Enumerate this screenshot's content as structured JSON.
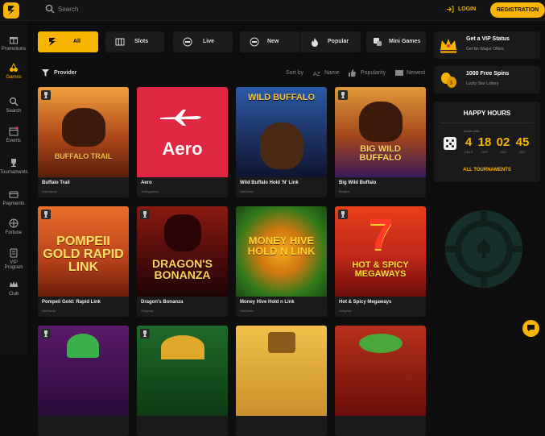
{
  "header": {
    "search_placeholder": "Search",
    "login_label": "LOGIN",
    "register_label": "REGISTRATION",
    "accent": "#f7b500"
  },
  "sidebar": {
    "items": [
      {
        "label": "Promotions",
        "icon": "gift-icon",
        "active": false
      },
      {
        "label": "Games",
        "icon": "cherries-icon",
        "active": true
      },
      {
        "label": "Search",
        "icon": "search-icon",
        "active": false
      },
      {
        "label": "Events",
        "icon": "calendar-icon",
        "active": false
      },
      {
        "label": "Tournaments",
        "icon": "trophy-icon",
        "active": false
      },
      {
        "label": "Payments",
        "icon": "card-icon",
        "active": false
      },
      {
        "label": "Fortune",
        "icon": "wheel-icon",
        "active": false
      },
      {
        "label": "VIP Program",
        "icon": "vip-icon",
        "active": false
      },
      {
        "label": "Club",
        "icon": "crown-icon",
        "active": false
      }
    ]
  },
  "tabs": [
    {
      "label": "All",
      "icon": "lightning-icon",
      "active": true
    },
    {
      "label": "Slots",
      "icon": "slots-icon",
      "active": false
    },
    {
      "label": "Live",
      "icon": "live-icon",
      "active": false
    },
    {
      "label": "New",
      "icon": "new-icon",
      "active": false
    },
    {
      "label": "Popular",
      "icon": "fire-icon",
      "active": false
    },
    {
      "label": "Mini Games",
      "icon": "dice-icon",
      "active": false
    }
  ],
  "filters": {
    "provider_label": "Provider",
    "sort_by_label": "Sort by",
    "sort_options": [
      "Name",
      "Popularity",
      "Newest"
    ]
  },
  "games": [
    {
      "title": "Buffalo Trail",
      "provider": "Gamebeat",
      "art": "BUFFALO TRAIL",
      "bg": "#8a3a14",
      "fg": "#f5c542"
    },
    {
      "title": "Aero",
      "provider": "Turbogames",
      "art": "Aero",
      "bg": "#d9263a",
      "fg": "#ffffff"
    },
    {
      "title": "Wild Buffalo Hold 'N' Link",
      "provider": "NetGame",
      "art": "WILD BUFFALO",
      "bg": "#1d3a6e",
      "fg": "#f5c542"
    },
    {
      "title": "Big Wild Buffalo",
      "provider": "Belatra",
      "art": "BIG WILD BUFFALO",
      "bg": "#6e2a14",
      "fg": "#ffd35a"
    },
    {
      "title": "Pompeii Gold: Rapid Link",
      "provider": "NetGame",
      "art": "POMPEII GOLD RAPID LINK",
      "bg": "#b8501a",
      "fg": "#ffe066"
    },
    {
      "title": "Dragon's Bonanza",
      "provider": "Onlyplay",
      "art": "DRAGON'S BONANZA",
      "bg": "#5a0e0e",
      "fg": "#ffd35a"
    },
    {
      "title": "Money Hive Hold n Link",
      "provider": "NetGame",
      "art": "MONEY HIVE HOLD N LINK",
      "bg": "#2f7a1c",
      "fg": "#ffcf2e"
    },
    {
      "title": "Hot & Spicy Megaways",
      "provider": "Onlyplay",
      "art": "HOT & SPICY MEGAWAYS",
      "bg": "#c2271a",
      "fg": "#ffde3b"
    }
  ],
  "promos": [
    {
      "title": "Get a VIP Status",
      "subtitle": "Get No Wager Offers",
      "icon": "crown-icon"
    },
    {
      "title": "1000 Free Spins",
      "subtitle": "Lucky Star Lottery",
      "icon": "coins-icon"
    }
  ],
  "happy_hours": {
    "title": "HAPPY HOURS",
    "active_label": "Active with:",
    "countdown": [
      {
        "value": "4",
        "unit": "DAYS"
      },
      {
        "value": "18",
        "unit": "HRS"
      },
      {
        "value": "02",
        "unit": "MIN"
      },
      {
        "value": "45",
        "unit": "SEC"
      }
    ],
    "link_label": "ALL TOURNAMENTS"
  }
}
